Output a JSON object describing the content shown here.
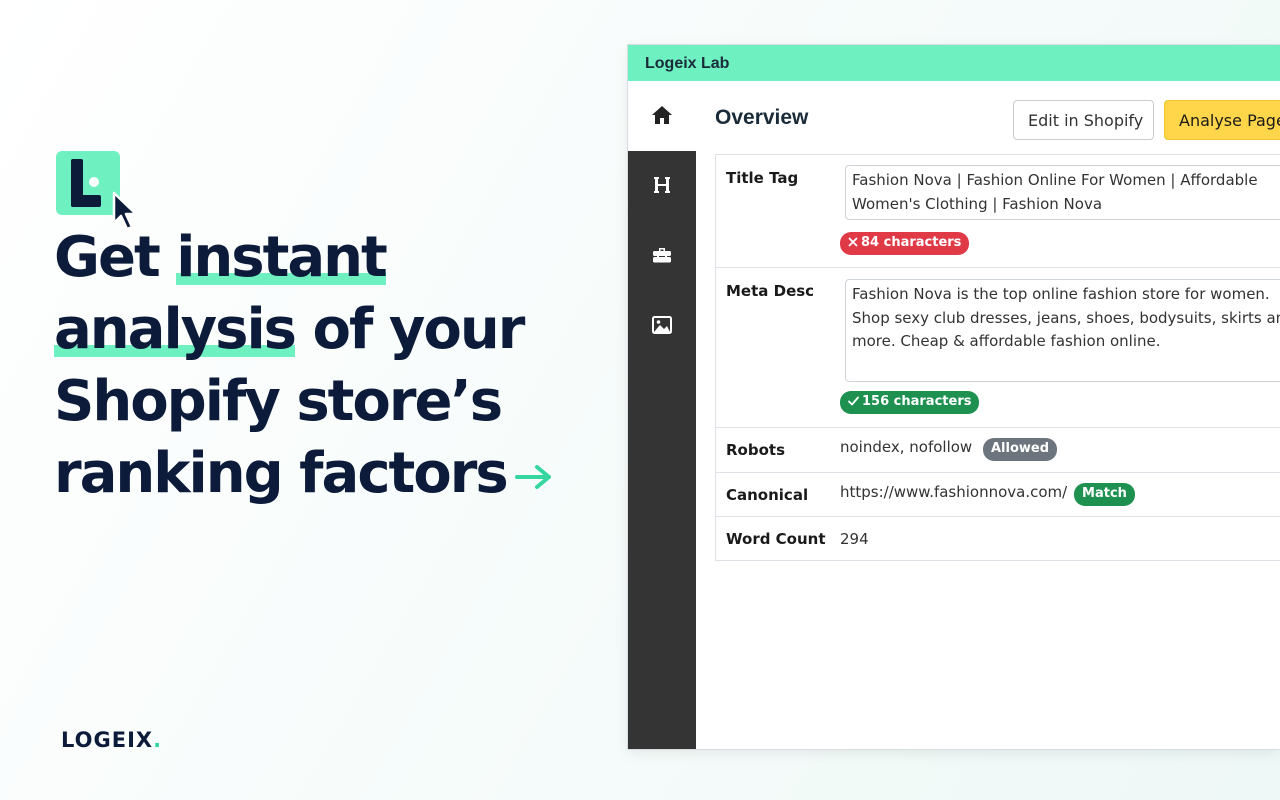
{
  "hero": {
    "line1_a": "Get ",
    "line1_b": "instant",
    "line2_a": "analysis",
    "line2_b": " of your",
    "line3": "Shopify store’s",
    "line4": "ranking factors",
    "arrow_icon": "arrow-right-icon"
  },
  "brand": {
    "name": "LOGEIX",
    "dot": "."
  },
  "app": {
    "title": "Logeix Lab",
    "sidebar_icons": [
      "home-icon",
      "heading-icon",
      "toolbox-icon",
      "image-icon"
    ],
    "page_title": "Overview",
    "edit_button": "Edit in Shopify",
    "analyse_button": "Analyse Page",
    "rows": {
      "title": {
        "label": "Title Tag",
        "value": "Fashion Nova | Fashion Online For Women | Affordable Women's Clothing | Fashion Nova",
        "badge": "84 characters",
        "badge_status": "error"
      },
      "meta": {
        "label": "Meta Desc",
        "value": "Fashion Nova is the top online fashion store for women. Shop sexy club dresses, jeans, shoes, bodysuits, skirts and more. Cheap & affordable fashion online.",
        "badge": "156 characters",
        "badge_status": "ok"
      },
      "robots": {
        "label": "Robots",
        "value": "noindex, nofollow",
        "badge": "Allowed"
      },
      "canonical": {
        "label": "Canonical",
        "value": "https://www.fashionnova.com/",
        "badge": "Match"
      },
      "wordcount": {
        "label": "Word Count",
        "value": "294"
      }
    }
  },
  "colors": {
    "accent": "#6ef0c0",
    "navy": "#0d1b3a",
    "analyse_button": "#ffd54a",
    "badge_red": "#e03a47",
    "badge_green": "#1e9150",
    "badge_grey": "#6c757d",
    "sidebar": "#343434"
  }
}
